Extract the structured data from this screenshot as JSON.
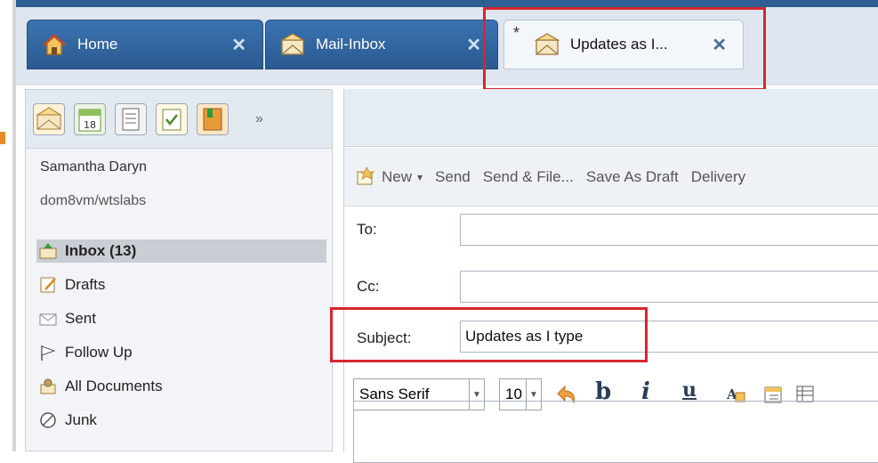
{
  "tabs": [
    {
      "label": "Home",
      "close": "✕",
      "icon": "home-icon"
    },
    {
      "label": "Mail-Inbox",
      "close": "✕",
      "icon": "mail-icon"
    },
    {
      "label": "Updates as I...",
      "close": "✕",
      "icon": "mail-icon",
      "dirty": "*"
    }
  ],
  "sidebar": {
    "user": "Samantha Daryn",
    "server": "dom8vm/wtslabs",
    "toolbar_icons": [
      "mail-icon",
      "calendar-icon",
      "contacts-icon",
      "todo-icon",
      "notebook-icon"
    ],
    "calendar_day": "18",
    "more": "»",
    "folders": [
      {
        "label": "Inbox (13)",
        "icon": "inbox-icon",
        "selected": true
      },
      {
        "label": "Drafts",
        "icon": "drafts-icon"
      },
      {
        "label": "Sent",
        "icon": "sent-icon"
      },
      {
        "label": "Follow Up",
        "icon": "flag-icon"
      },
      {
        "label": "All Documents",
        "icon": "documents-icon"
      },
      {
        "label": "Junk",
        "icon": "junk-icon"
      }
    ]
  },
  "compose": {
    "actions": {
      "new": "New",
      "send": "Send",
      "send_file": "Send & File...",
      "save_draft": "Save As Draft",
      "delivery": "Delivery"
    },
    "to_label": "To:",
    "cc_label": "Cc:",
    "subject_label": "Subject:",
    "subject_value": "Updates as I type",
    "font": "Sans Serif",
    "size": "10",
    "format_buttons": [
      "b",
      "i",
      "u"
    ]
  },
  "colors": {
    "accent": "#2f5e93",
    "highlight": "#d6262e",
    "selected_folder": "#c9ced4"
  }
}
